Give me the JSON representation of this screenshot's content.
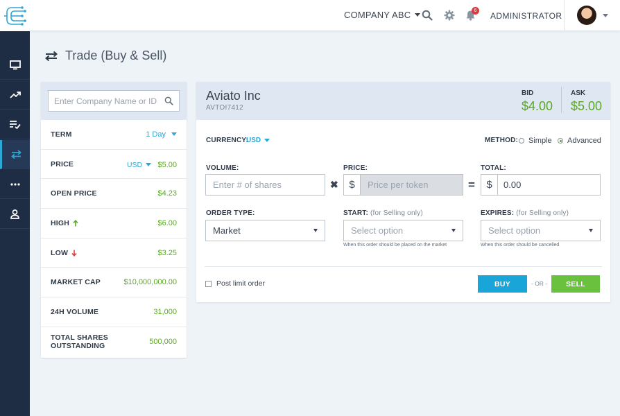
{
  "header": {
    "company": "COMPANY ABC",
    "notification_count": "6",
    "user": "ADMINISTRATOR"
  },
  "sidebar": {
    "items": [
      {
        "icon": "monitor-icon",
        "name": "dashboard"
      },
      {
        "icon": "trending-up-icon",
        "name": "markets"
      },
      {
        "icon": "checklist-icon",
        "name": "orders"
      },
      {
        "icon": "swap-arrows-icon",
        "name": "trade",
        "active": true
      },
      {
        "icon": "more-dots-icon",
        "name": "more"
      },
      {
        "icon": "user-icon",
        "name": "profile"
      }
    ]
  },
  "page": {
    "title": "Trade (Buy & Sell)"
  },
  "search": {
    "placeholder": "Enter Company Name or ID"
  },
  "stats": {
    "term_label": "TERM",
    "term_value": "1 Day",
    "price_label": "PRICE",
    "price_currency": "USD",
    "price_value": "$5.00",
    "open_price_label": "OPEN PRICE",
    "open_price_value": "$4.23",
    "high_label": "HIGH",
    "high_value": "$6.00",
    "low_label": "LOW",
    "low_value": "$3.25",
    "market_cap_label": "MARKET CAP",
    "market_cap_value": "$10,000,000.00",
    "volume_label": "24H VOLUME",
    "volume_value": "31,000",
    "shares_label_1": "TOTAL SHARES",
    "shares_label_2": "OUTSTANDING",
    "shares_value": "500,000"
  },
  "company": {
    "name": "Aviato Inc",
    "id": "AVTOI7412",
    "bid_label": "BID",
    "bid_value": "$4.00",
    "ask_label": "ASK",
    "ask_value": "$5.00"
  },
  "form": {
    "currency_label": "CURRENCY:",
    "currency_value": "USD",
    "method_label": "METHOD:",
    "method_simple": "Simple",
    "method_advanced": "Advanced",
    "method_selected": "Advanced",
    "volume_label": "VOLUME:",
    "volume_placeholder": "Enter # of shares",
    "price_label": "PRICE:",
    "price_placeholder": "Price per token",
    "total_label": "TOTAL:",
    "total_value": "0.00",
    "currency_symbol": "$",
    "order_type_label": "ORDER TYPE:",
    "order_type_value": "Market",
    "start_label": "START:",
    "start_sub": "(for Selling only)",
    "start_placeholder": "Select option",
    "start_hint": "When this order should be placed on the market",
    "expires_label": "EXPIRES:",
    "expires_sub": "(for Selling only)",
    "expires_placeholder": "Select option",
    "expires_hint": "When this order should be cancelled",
    "post_limit_label": "Post limit order",
    "buy_label": "BUY",
    "or_label": "- OR -",
    "sell_label": "SELL"
  },
  "colors": {
    "sidebar_bg": "#1e2d44",
    "accent_blue": "#1aa5d9",
    "accent_green": "#69c13d",
    "price_green": "#5aa822",
    "panel_head": "#dfe8f2"
  }
}
